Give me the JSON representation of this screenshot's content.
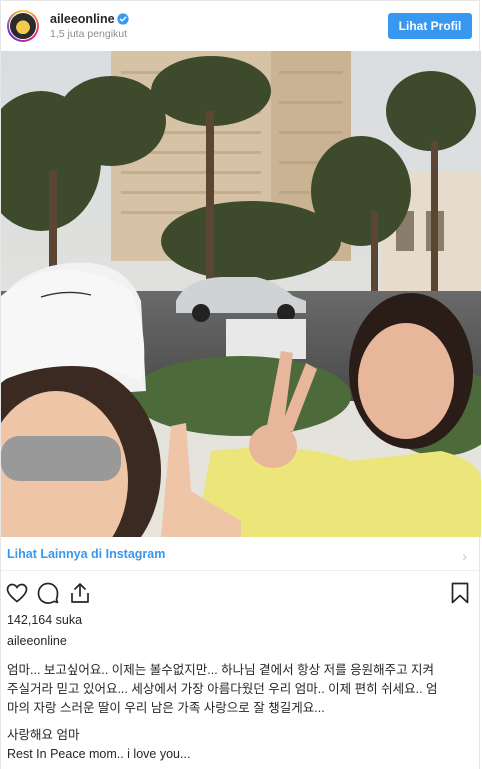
{
  "header": {
    "username": "aileeonline",
    "followers": "1,5 juta pengikut",
    "profile_button": "Lihat Profil"
  },
  "photo": {
    "icon": "photo-scene"
  },
  "link_row": {
    "label": "Lihat Lainnya di Instagram",
    "chevron": "›"
  },
  "actions": {
    "icons": [
      "heart-icon",
      "comment-icon",
      "share-icon",
      "bookmark-icon"
    ]
  },
  "post": {
    "likes": "142,164 suka",
    "caption_user": "aileeonline",
    "caption_body": "엄마... 보고싶어요.. 이제는 볼수없지만... 하나님 곁에서 항상 저를 응원해주고 지켜\n주실거라 믿고 있어요... 세상에서 가장 아름다웠던 우리 엄마.. 이제 편히 쉬세요.. 엄\n마의 자랑 스러운 딸이 우리 남은 가족 사랑으로 잘 챙길게요...",
    "caption_tail": "사랑해요 엄마\nRest In Peace mom.. i love you..."
  },
  "colors": {
    "accent": "#3897f0",
    "text": "#262626",
    "muted": "#8e8e8e"
  }
}
